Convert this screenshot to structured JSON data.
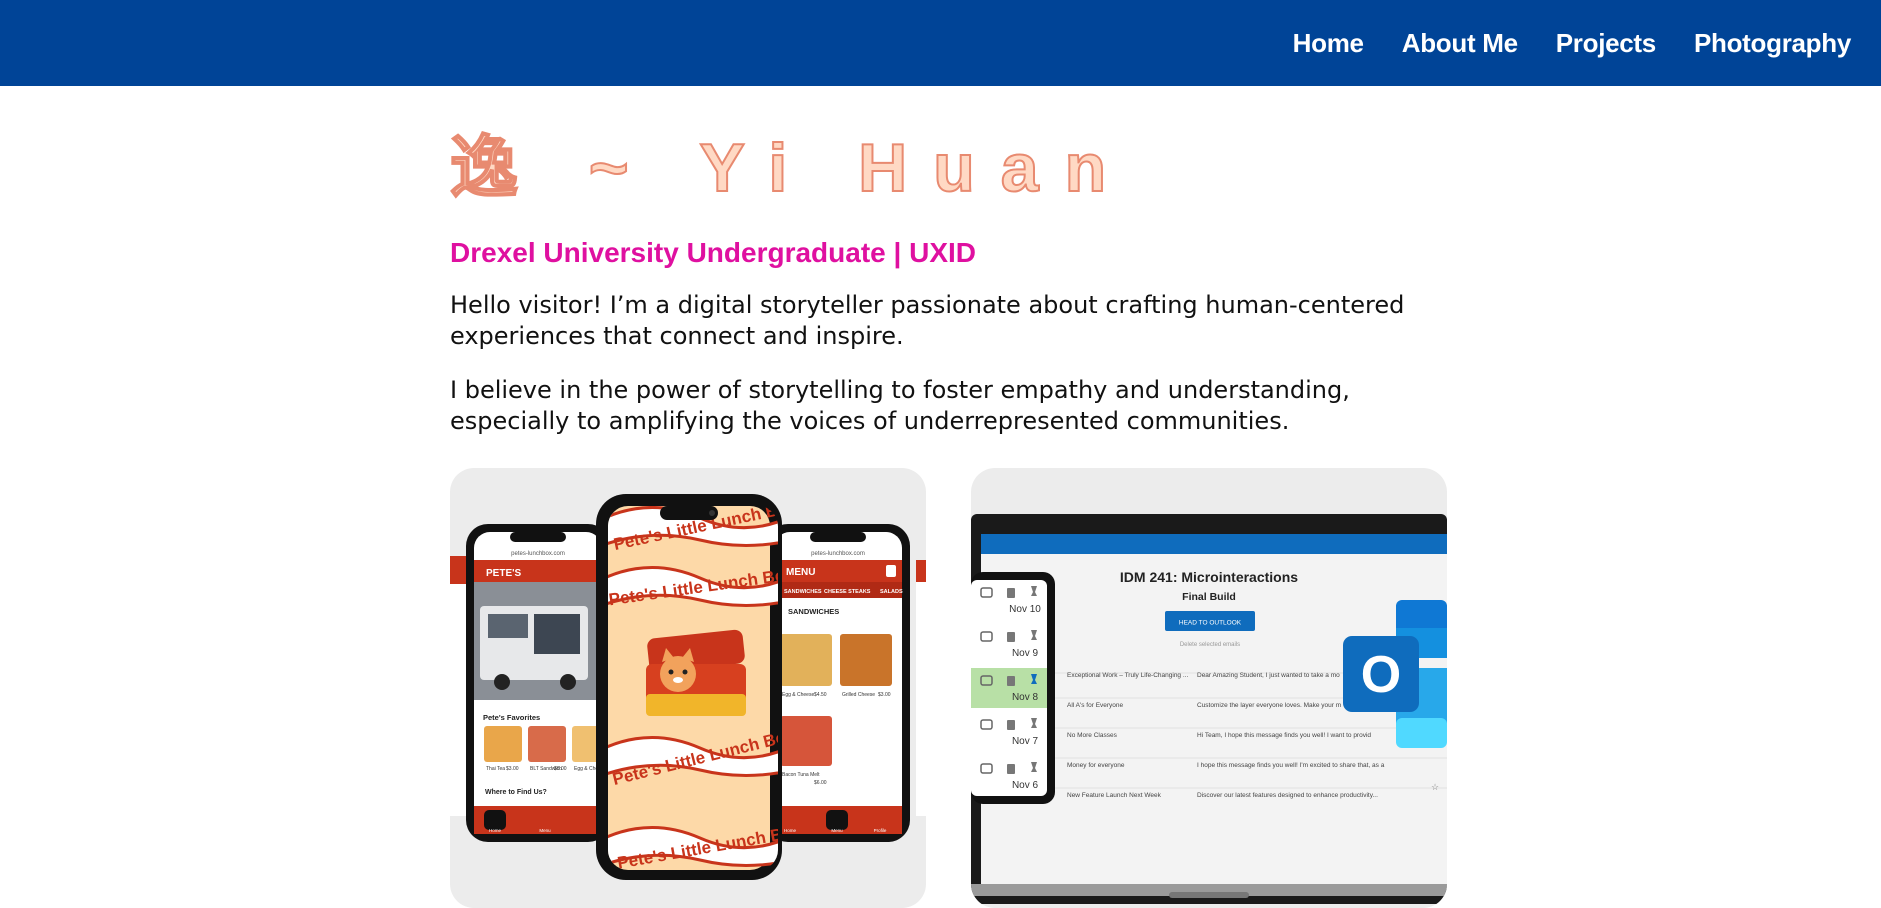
{
  "nav": {
    "items": [
      {
        "label": "Home"
      },
      {
        "label": "About Me"
      },
      {
        "label": "Projects"
      },
      {
        "label": "Photography"
      }
    ]
  },
  "hero": {
    "title": "逸 ~ Yi Huan",
    "subtitle": "Drexel University Undergraduate | UXID",
    "paragraphs": [
      "Hello visitor! I’m a digital storyteller passionate about crafting human-centered experiences that connect and inspire.",
      "I believe in the power of storytelling to foster empathy and understanding, especially to amplifying the voices of underrepresented communities."
    ]
  },
  "cards": [
    {
      "left_phone": {
        "url": "petes-lunchbox.com",
        "brand": "PETE'S",
        "section": "Pete's Favorites",
        "items": [
          {
            "name": "Thai Tea",
            "price": "$3.00"
          },
          {
            "name": "BLT Sandwich",
            "price": "$6.00"
          },
          {
            "name": "Egg & Cheese",
            "price": ""
          }
        ],
        "find_label": "Where to Find Us?",
        "tabs": [
          "Home",
          "Menu"
        ]
      },
      "center_phone": {
        "wave_text": "Pete's Little Lunch Box"
      },
      "right_phone": {
        "url": "petes-lunchbox.com",
        "header": "MENU",
        "tabs": [
          "SANDWICHES",
          "CHEESE STEAKS",
          "SALADS"
        ],
        "section": "SANDWICHES",
        "items": [
          {
            "name": "Egg & Cheese",
            "price": "$4.50"
          },
          {
            "name": "Grilled Cheese",
            "price": "$3.00"
          },
          {
            "name": "Bacon Tuna Melt",
            "price": "$6.00"
          }
        ],
        "nav": [
          "Home",
          "Menu",
          "Profile"
        ]
      }
    },
    {
      "title": "IDM 241: Microinteractions",
      "subtitle": "Final Build",
      "button": "HEAD TO OUTLOOK",
      "caption": "Delete selected emails",
      "emails": [
        {
          "subject": "Exceptional Work – Truly Life-Changing ...",
          "preview": "Dear Amazing Student, I just wanted to take a mo"
        },
        {
          "subject": "All A's for Everyone",
          "preview": "Customize the layer everyone loves. Make your m"
        },
        {
          "subject": "No More Classes",
          "preview": "Hi Team, I hope this message finds you well! I want to provid"
        },
        {
          "subject": "Money for everyone",
          "preview": "I hope this message finds you well! I'm excited to share that, as a"
        },
        {
          "subject": "New Feature Launch Next Week",
          "preview": "Discover our latest features designed to enhance productivity..."
        }
      ],
      "dates": [
        "Nov 10",
        "Nov 9",
        "Nov 8",
        "Nov 7",
        "Nov 6"
      ],
      "logo_letter": "O"
    }
  ],
  "colors": {
    "nav_bg": "#004497",
    "accent_pink": "#df10a0",
    "title_peach": "#e88a70",
    "card_bg": "#ececec",
    "brand_red": "#c8341b",
    "outlook_blue": "#0f6cbd"
  }
}
